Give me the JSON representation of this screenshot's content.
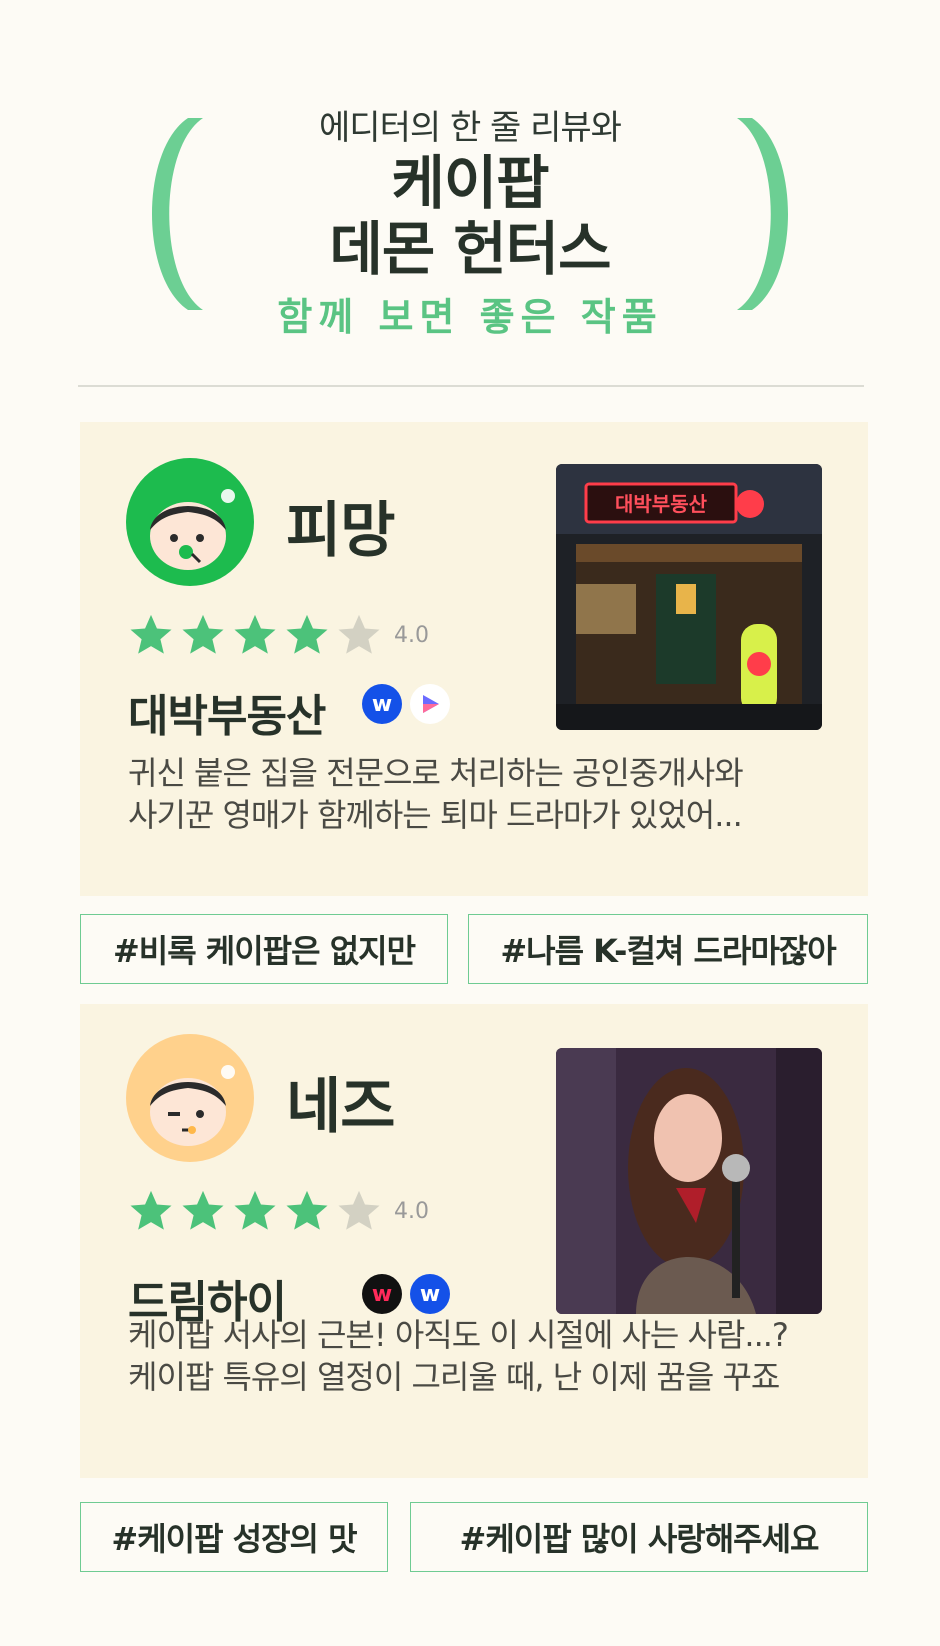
{
  "header": {
    "kicker": "에디터의 한 줄 리뷰와",
    "title_line1": "케이팝",
    "title_line2": "데몬 헌터스",
    "subtitle": "함께 보면 좋은 작품",
    "accent_color": "#6ccf93"
  },
  "reviews": [
    {
      "editor": "피망",
      "avatar_icon": "green-face-avatar",
      "rating": "4.0",
      "stars_filled": 4,
      "stars_total": 5,
      "work_title": "대박부동산",
      "platforms": [
        "wavve-w-icon",
        "play-triangle-icon"
      ],
      "review_line1": "귀신 붙은 집을 전문으로 처리하는 공인중개사와",
      "review_line2": "사기꾼 영매가 함께하는 퇴마 드라마가 있었어...",
      "tags": [
        "#비록 케이팝은 없지만",
        "#나름 K-컬쳐 드라마잖아"
      ]
    },
    {
      "editor": "네즈",
      "avatar_icon": "orange-face-avatar",
      "rating": "4.0",
      "stars_filled": 4,
      "stars_total": 5,
      "work_title": "드림하이",
      "platforms": [
        "wavve-icon",
        "w-icon"
      ],
      "review_line1": "케이팝 서사의 근본! 아직도 이 시절에 사는 사람...?",
      "review_line2": "케이팝 특유의 열정이 그리울 때, 난 이제 꿈을 꾸죠",
      "tags": [
        "#케이팝 성장의 맛",
        "#케이팝 많이 사랑해주세요"
      ]
    }
  ],
  "colors": {
    "star_filled": "#4cc27a",
    "star_empty": "#d3d1c3",
    "card_bg": "#faf4e1",
    "page_bg": "#fdfbf5"
  }
}
